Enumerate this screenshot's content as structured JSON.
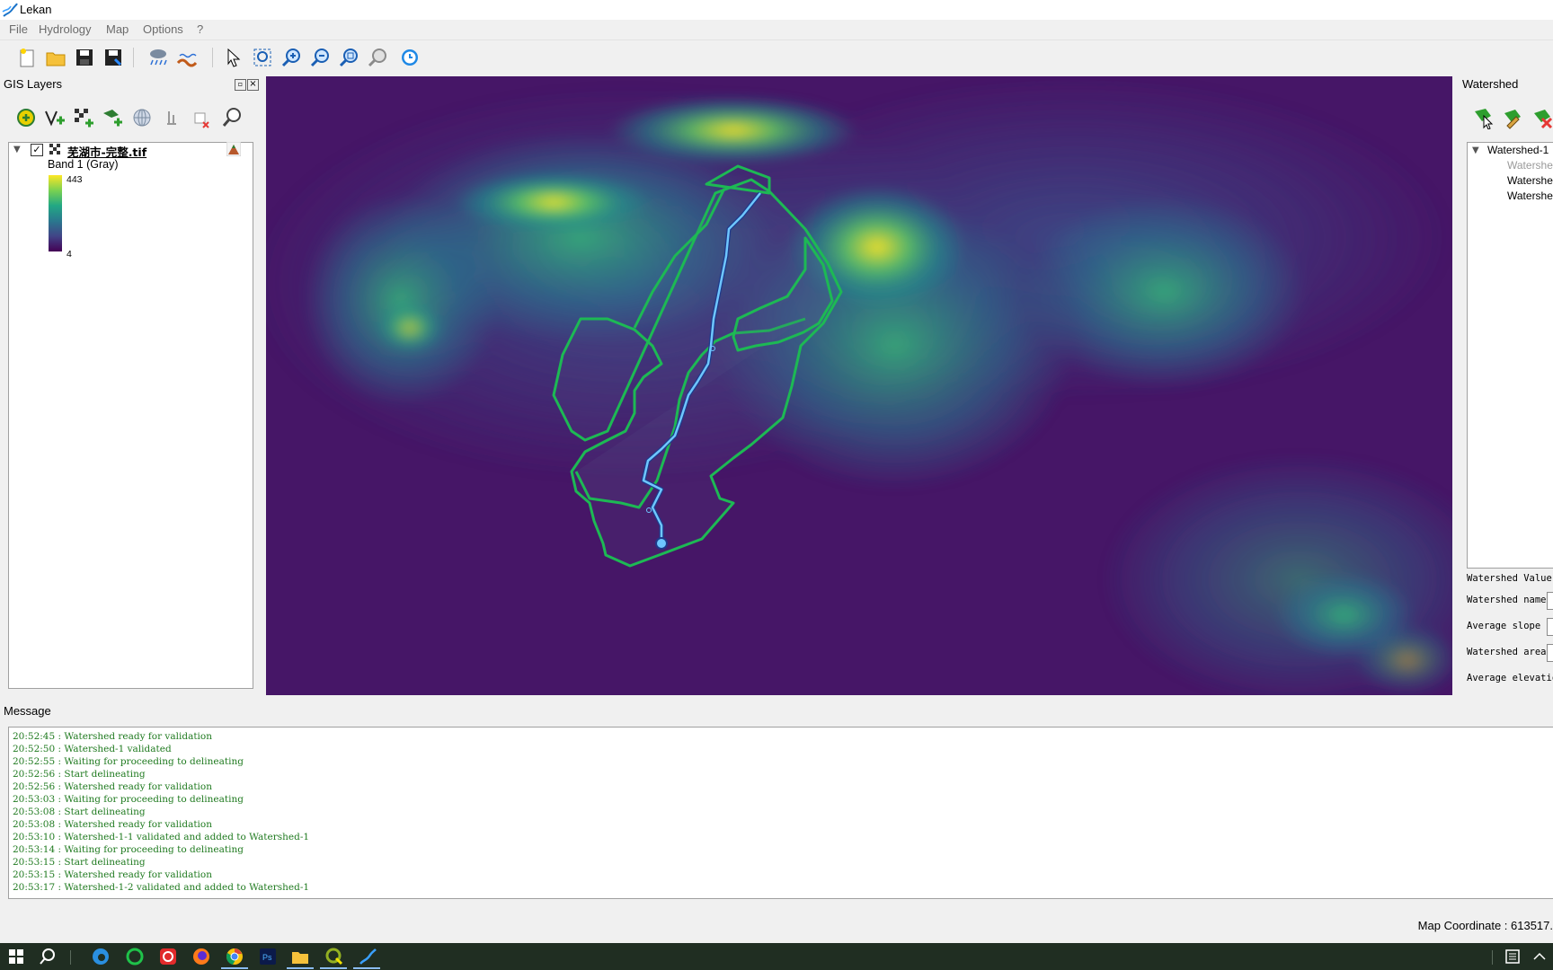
{
  "window": {
    "title": "Lekan"
  },
  "menu": [
    "File",
    "Hydrology",
    "Map",
    "Options",
    "?"
  ],
  "gis_panel": {
    "title": "GIS Layers",
    "layer": {
      "name": "芜湖市-完整.tif",
      "checked": true,
      "band": "Band 1 (Gray)",
      "max": "443",
      "min": "4"
    }
  },
  "watershed_panel": {
    "title": "Watershed",
    "tree": {
      "root": "Watershed-1",
      "children": [
        "Watershe",
        "Watershe",
        "Watershe"
      ]
    },
    "values_title": "Watershed Values",
    "fields": [
      {
        "label": "Watershed name"
      },
      {
        "label": "Average slope"
      },
      {
        "label": "Watershed area"
      },
      {
        "label": "Average elevatio"
      }
    ]
  },
  "message_panel": {
    "title": "Message",
    "log": [
      "20:52:45 : Watershed ready for validation",
      "20:52:50 : Watershed-1 validated",
      "20:52:55 : Waiting for proceeding to delineating",
      "20:52:56 : Start delineating",
      "20:52:56 : Watershed ready for validation",
      "20:53:03 : Waiting for proceeding to delineating",
      "20:53:08 : Start delineating",
      "20:53:08 : Watershed ready for validation",
      "20:53:10 : Watershed-1-1 validated and added to Watershed-1",
      "20:53:14 : Waiting for proceeding to delineating",
      "20:53:15 : Start delineating",
      "20:53:15 : Watershed ready for validation",
      "20:53:17 : Watershed-1-2 validated and added to Watershed-1"
    ]
  },
  "status": {
    "map_coordinate": "Map Coordinate : 613517."
  },
  "colors": {
    "watershed_outline": "#1db954",
    "stream": "#6ec6ff",
    "dem_low": "#440154",
    "dem_high": "#fde725",
    "log_text": "#1f7a1f"
  }
}
